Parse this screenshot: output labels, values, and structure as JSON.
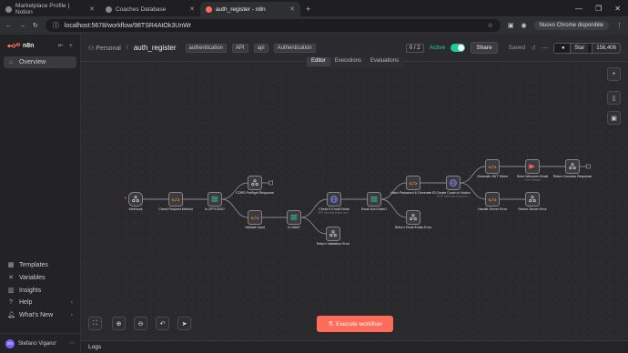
{
  "browser": {
    "tabs": [
      {
        "title": "Marketplace Profile | Notion"
      },
      {
        "title": "Coaches Database"
      },
      {
        "title": "auth_register - n8n"
      }
    ],
    "url": "localhost:5678/workflow/98TSR4AtOk3UnWr",
    "chrome_badge": "Nuovo Chrome disponibile"
  },
  "sidebar": {
    "brand": "n8n",
    "items": [
      {
        "label": "Overview",
        "icon": "home-icon"
      }
    ],
    "bottom": [
      {
        "label": "Templates",
        "icon": "templates-icon"
      },
      {
        "label": "Variables",
        "icon": "variables-icon"
      },
      {
        "label": "Insights",
        "icon": "insights-icon"
      },
      {
        "label": "Help",
        "icon": "help-icon"
      },
      {
        "label": "What's New",
        "icon": "bell-icon"
      }
    ],
    "user": {
      "initials": "SV",
      "name": "Stefano Vigano'"
    }
  },
  "header": {
    "project": "Personal",
    "workflow_name": "auth_register",
    "tags": [
      "authentication",
      "API",
      "api",
      "Authentication"
    ],
    "counter": "0 / 2",
    "active_label": "Active",
    "share_label": "Share",
    "saved_label": "Saved",
    "star_label": "Star",
    "star_count": "156,406"
  },
  "view_tabs": [
    "Editor",
    "Executions",
    "Evaluations"
  ],
  "execute_label": "Execute workflow",
  "logs_label": "Logs",
  "nodes": [
    {
      "label": "Webhook",
      "sub": "",
      "type": "webhook"
    },
    {
      "label": "Check Request Method",
      "sub": "",
      "type": "code"
    },
    {
      "label": "Is OPTIONS?",
      "sub": "",
      "type": "if"
    },
    {
      "label": "CORS Preflight Response",
      "sub": "",
      "type": "webhook"
    },
    {
      "label": "Validate Input",
      "sub": "",
      "type": "code"
    },
    {
      "label": "Is Valid?",
      "sub": "",
      "type": "if"
    },
    {
      "label": "Return Validation Error",
      "sub": "",
      "type": "webhook"
    },
    {
      "label": "Check If Email Exists",
      "sub": "GET: https://api.airtable.com/...",
      "type": "http"
    },
    {
      "label": "Email Not Exists?",
      "sub": "",
      "type": "if"
    },
    {
      "label": "Hash Password & Generate ID",
      "sub": "",
      "type": "code"
    },
    {
      "label": "Return Email Exists Error",
      "sub": "",
      "type": "webhook"
    },
    {
      "label": "Create Coach in Notion",
      "sub": "POST: https://api.notion.com/...",
      "type": "http"
    },
    {
      "label": "Generate JWT Token",
      "sub": "",
      "type": "code"
    },
    {
      "label": "Handle Server Error",
      "sub": "",
      "type": "code"
    },
    {
      "label": "Send Welcome Email",
      "sub": "send: message",
      "type": "email"
    },
    {
      "label": "Return Server Error",
      "sub": "",
      "type": "webhook"
    },
    {
      "label": "Return Success Response",
      "sub": "",
      "type": "webhook"
    }
  ]
}
